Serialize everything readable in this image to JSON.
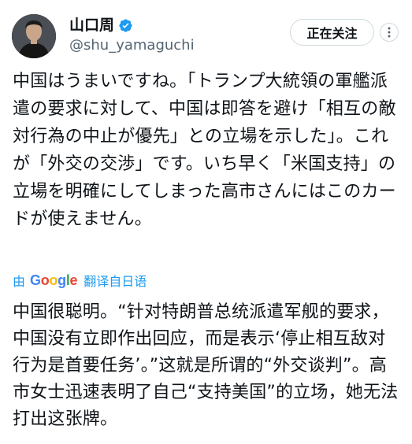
{
  "author": {
    "display_name": "山口周",
    "handle": "@shu_yamaguchi",
    "verified": true
  },
  "actions": {
    "follow_label": "正在关注"
  },
  "tweet": {
    "original_text": "中国はうまいですね。「トランプ大統領の軍艦派遣の要求に対して、中国は即答を避け「相互の敵対行為の中止が優先」との立場を示した」。これが「外交の交渉」です。いち早く「米国支持」の立場を明確にしてしまった高市さんにはこのカードが使えません。",
    "translation": {
      "by_label": "由",
      "provider": "Google",
      "action_label": "翻译自日语"
    },
    "translated_text": "中国很聪明。“针对特朗普总统派遣军舰的要求，中国没有立即作出回应，而是表示‘停止相互敌对行为是首要任务’。”这就是所谓的“外交谈判”。高市女士迅速表明了自己“支持美国”的立场，她无法打出这张牌。"
  },
  "colors": {
    "accent": "#1d9bf0",
    "text": "#0f1419",
    "secondary_text": "#536471",
    "border": "#cfd9de"
  },
  "icons": {
    "verified": "verified-badge-icon",
    "more": "more-options-icon"
  }
}
